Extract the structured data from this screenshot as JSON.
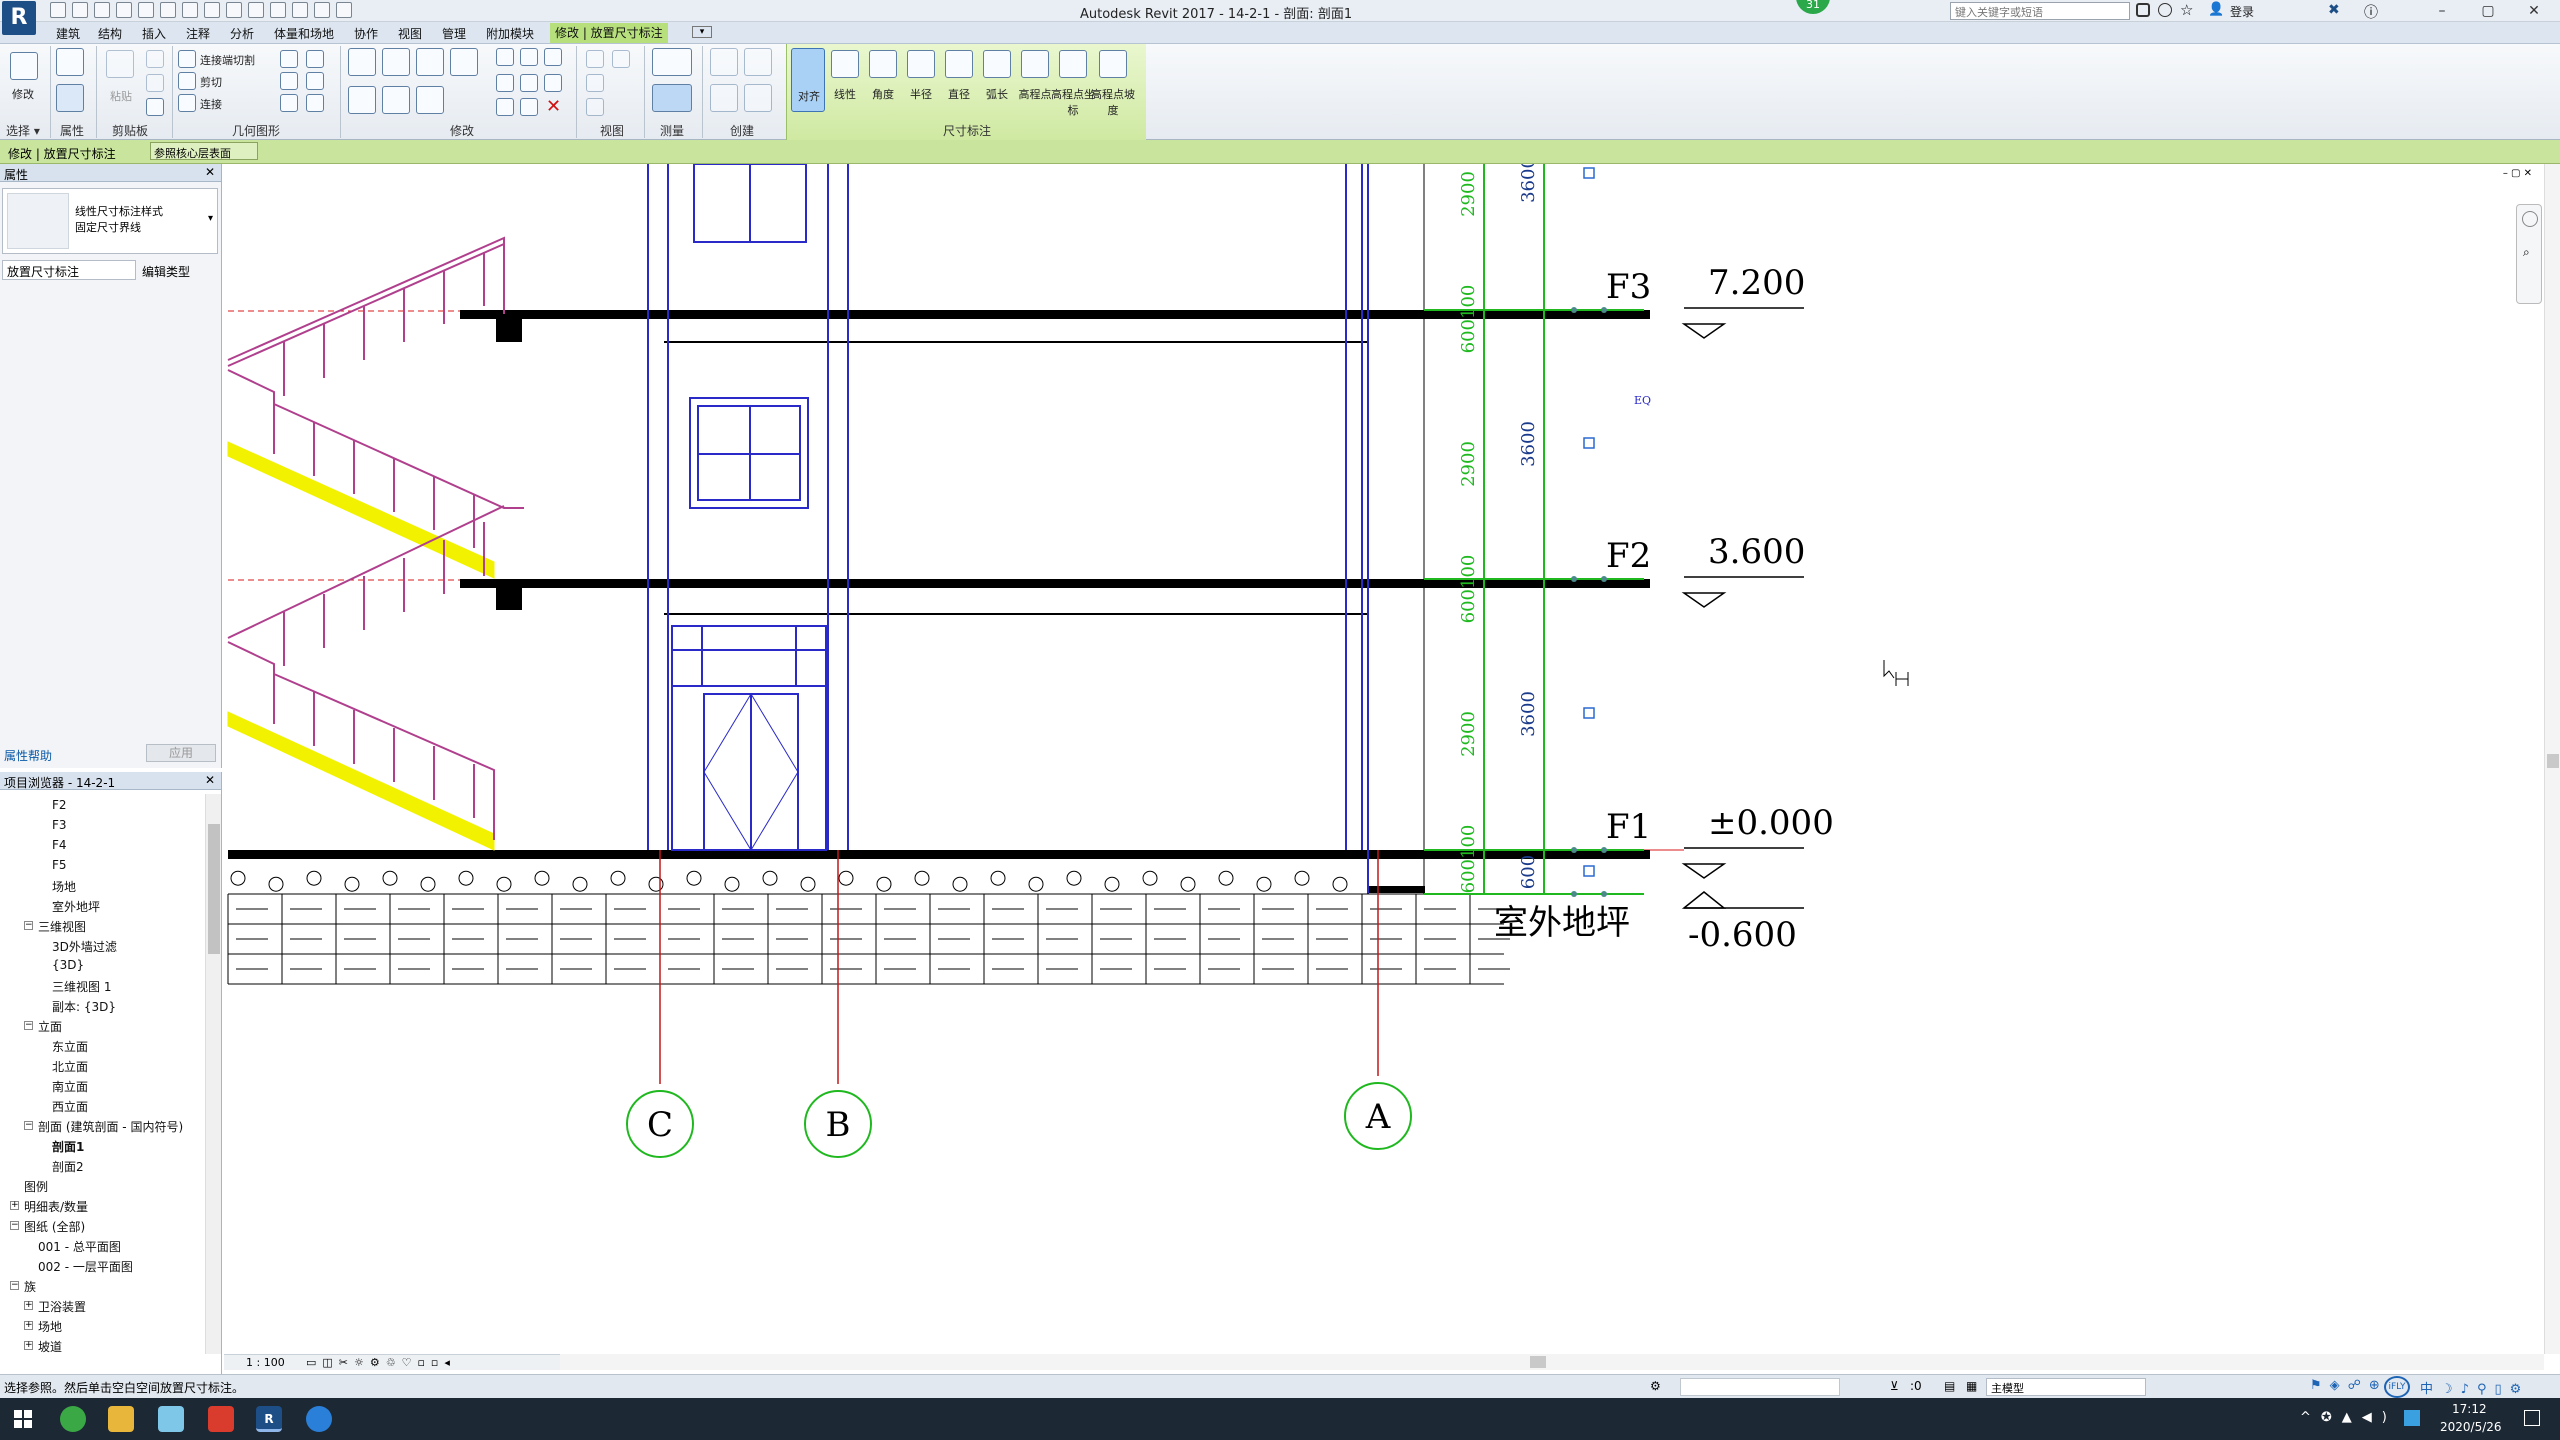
{
  "window": {
    "title": "Autodesk Revit 2017 -     14-2-1 - 剖面: 剖面1",
    "search_placeholder": "键入关键字或短语",
    "login": "登录",
    "minimize": "–",
    "maximize": "▢",
    "close": "✕"
  },
  "ribbon_tabs": [
    "建筑",
    "结构",
    "插入",
    "注释",
    "分析",
    "体量和场地",
    "协作",
    "视图",
    "管理",
    "附加模块",
    "修改 | 放置尺寸标注"
  ],
  "ribbon": {
    "modify_label": "修改",
    "panel_select": "选择 ▾",
    "panel_properties": "属性",
    "panel_clipboard": "剪贴板",
    "panel_geometry": "几何图形",
    "panel_modify": "修改",
    "panel_view": "视图",
    "panel_measure": "测量",
    "panel_create": "创建",
    "panel_dimension": "尺寸标注",
    "join_cut": "连接端切割",
    "cut": "剪切",
    "join": "连接",
    "paste": "粘贴",
    "dim_tools": [
      "对齐",
      "线性",
      "角度",
      "半径",
      "直径",
      "弧长",
      "高程点",
      "高程点坐标",
      "高程点坡度"
    ]
  },
  "options_bar": {
    "context": "修改 | 放置尺寸标注",
    "reference": "参照核心层表面"
  },
  "properties": {
    "title": "属性",
    "type_line1": "线性尺寸标注样式",
    "type_line2": "固定尺寸界线",
    "selector": "放置尺寸标注",
    "edit_type": "编辑类型",
    "help": "属性帮助",
    "apply": "应用"
  },
  "browser": {
    "title": "项目浏览器 - 14-2-1",
    "items": [
      {
        "label": "F2",
        "level": 3
      },
      {
        "label": "F3",
        "level": 3
      },
      {
        "label": "F4",
        "level": 3
      },
      {
        "label": "F5",
        "level": 3
      },
      {
        "label": "场地",
        "level": 3
      },
      {
        "label": "室外地坪",
        "level": 3
      },
      {
        "label": "三维视图",
        "level": 2,
        "toggle": "−"
      },
      {
        "label": "3D外墙过滤",
        "level": 3
      },
      {
        "label": "{3D}",
        "level": 3
      },
      {
        "label": "三维视图 1",
        "level": 3
      },
      {
        "label": "副本: {3D}",
        "level": 3
      },
      {
        "label": "立面",
        "level": 2,
        "toggle": "−"
      },
      {
        "label": "东立面",
        "level": 3
      },
      {
        "label": "北立面",
        "level": 3
      },
      {
        "label": "南立面",
        "level": 3
      },
      {
        "label": "西立面",
        "level": 3
      },
      {
        "label": "剖面 (建筑剖面 - 国内符号)",
        "level": 2,
        "toggle": "−"
      },
      {
        "label": "剖面1",
        "level": 3,
        "bold": true
      },
      {
        "label": "剖面2",
        "level": 3
      },
      {
        "label": "图例",
        "level": 1
      },
      {
        "label": "明细表/数量",
        "level": 1,
        "toggle": "+"
      },
      {
        "label": "图纸 (全部)",
        "level": 1,
        "toggle": "−"
      },
      {
        "label": "001 - 总平面图",
        "level": 2
      },
      {
        "label": "002 - 一层平面图",
        "level": 2
      },
      {
        "label": "族",
        "level": 1,
        "toggle": "−"
      },
      {
        "label": "卫浴装置",
        "level": 2,
        "toggle": "+"
      },
      {
        "label": "场地",
        "level": 2,
        "toggle": "+"
      },
      {
        "label": "坡道",
        "level": 2,
        "toggle": "+"
      }
    ]
  },
  "drawing": {
    "levels": [
      {
        "name": "F3",
        "elevation": "7.200"
      },
      {
        "name": "F2",
        "elevation": "3.600"
      },
      {
        "name": "F1",
        "elevation": "±0.000"
      },
      {
        "name": "室外地坪",
        "elevation": "-0.600"
      }
    ],
    "grids": [
      "C",
      "B",
      "A"
    ],
    "dims_outer": [
      "3600",
      "3600",
      "3600",
      "600"
    ],
    "dims_inner": [
      "2900",
      "600100",
      "2900",
      "600100",
      "2900",
      "600100"
    ],
    "eq_label": "EQ",
    "colors": {
      "dim_green": "#1fb81f",
      "stair_yellow": "#f2f200",
      "window_blue": "#2a2ac8",
      "grid_red": "#c01818",
      "rail_magenta": "#b0408e"
    }
  },
  "view_bar": {
    "scale": "1 : 100"
  },
  "status": {
    "text": "选择参照。然后单击空白空间放置尺寸标注。",
    "zero": ":0",
    "model": "主模型"
  },
  "taskbar": {
    "time": "17:12",
    "date": "2020/5/26",
    "badge": "31"
  }
}
